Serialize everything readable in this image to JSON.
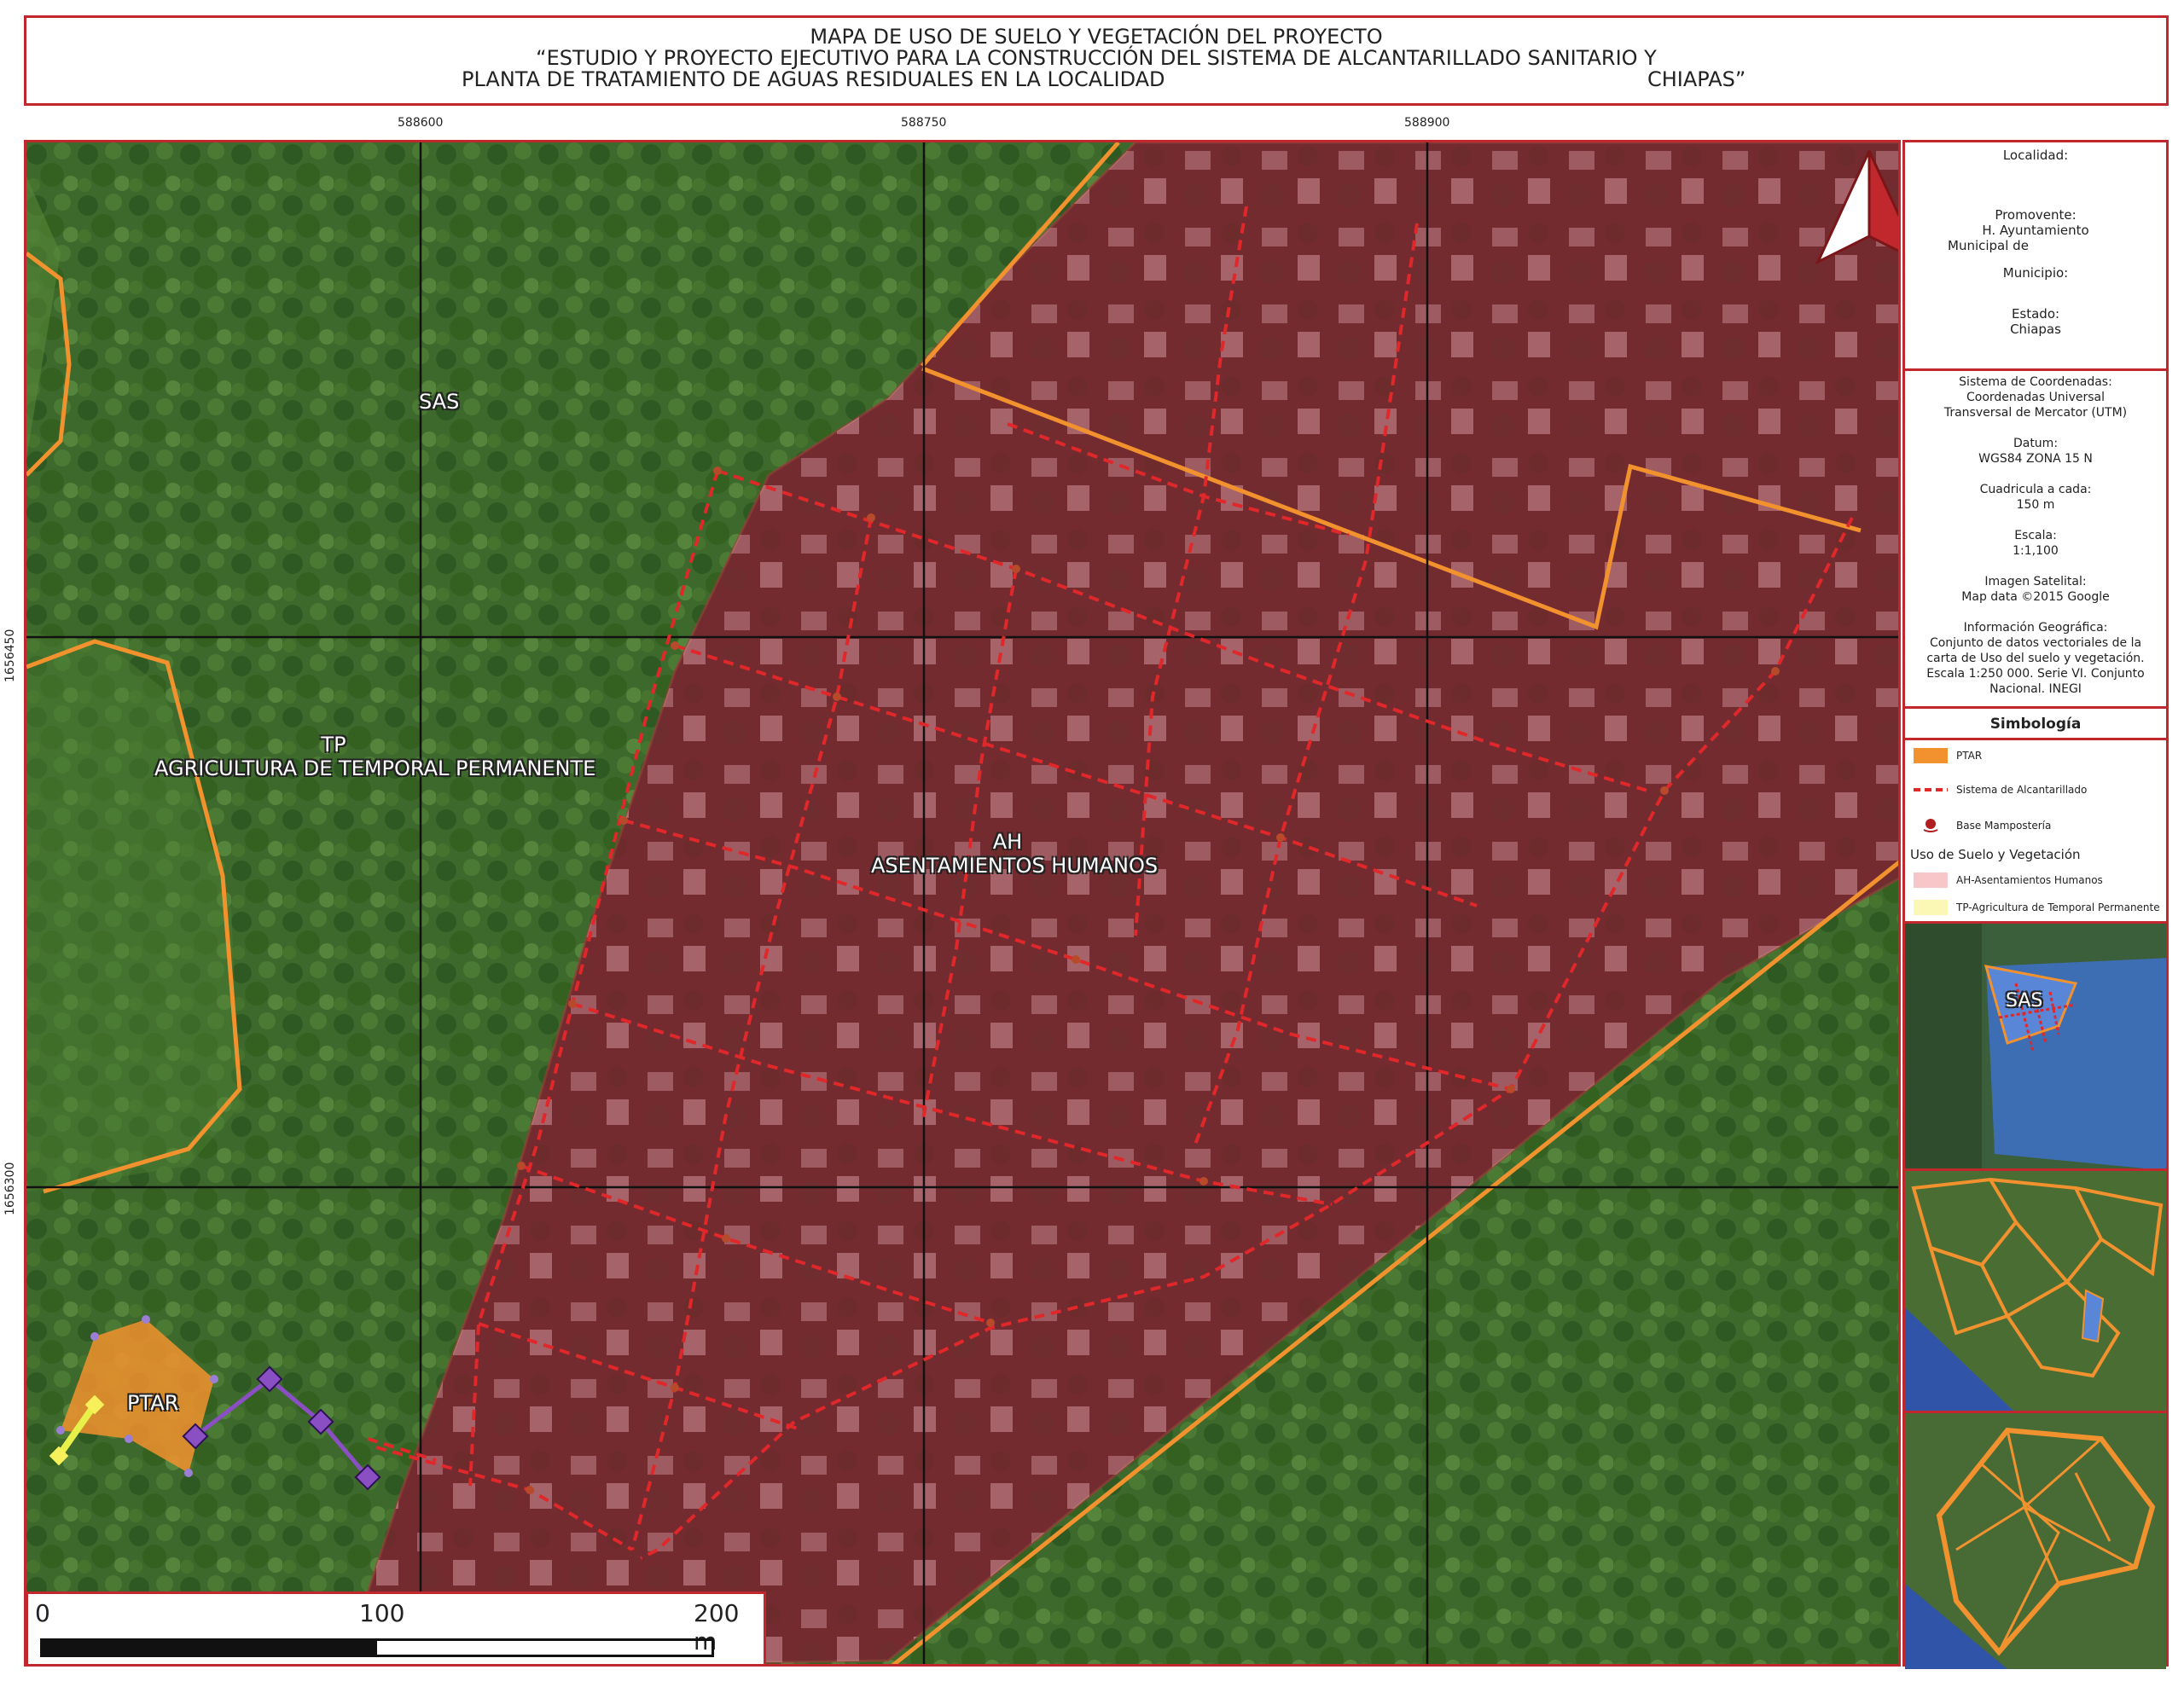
{
  "title": {
    "line1": "MAPA DE USO DE SUELO Y VEGETACIÓN DEL PROYECTO",
    "line2": "“ESTUDIO Y PROYECTO EJECUTIVO PARA LA CONSTRUCCIÓN DEL SISTEMA DE ALCANTARILLADO SANITARIO Y",
    "line3_left": "PLANTA DE TRATAMIENTO DE AGUAS RESIDUALES EN LA LOCALIDAD",
    "line3_right": "CHIAPAS”"
  },
  "grid": {
    "x_ticks": [
      "588600",
      "588750",
      "588900"
    ],
    "y_ticks": [
      "1656450",
      "1656300"
    ]
  },
  "map_labels": {
    "sas": "SAS",
    "tp_code": "TP",
    "tp_name": "AGRICULTURA DE TEMPORAL PERMANENTE",
    "ah_code": "AH",
    "ah_name": "ASENTAMIENTOS HUMANOS",
    "ptar": "PTAR"
  },
  "scalebar": {
    "labels": [
      "0",
      "100",
      "200 m"
    ]
  },
  "info": {
    "localidad": "Localidad:",
    "promovente_label": "Promovente:",
    "promovente_line1": "H. Ayuntamiento",
    "promovente_line2": "Municipal de",
    "municipio": "Municipio:",
    "estado_label": "Estado:",
    "estado_value": "Chiapas"
  },
  "coords": {
    "sistema_label": "Sistema de Coordenadas:",
    "sistema_line1": "Coordenadas Universal",
    "sistema_line2": "Transversal de Mercator (UTM)",
    "datum_label": "Datum:",
    "datum_value": "WGS84 ZONA 15 N",
    "cuadricula_label": "Cuadricula a cada:",
    "cuadricula_value": "150 m",
    "escala_label": "Escala:",
    "escala_value": "1:1,100",
    "imagen_label": "Imagen Satelital:",
    "imagen_value": "Map data ©2015 Google",
    "info_label": "Información Geográfica:",
    "info_line1": "Conjunto de datos vectoriales de la",
    "info_line2": "carta de Uso del suelo y vegetación.",
    "info_line3": "Escala 1:250 000. Serie VI. Conjunto",
    "info_line4": "Nacional. INEGI"
  },
  "legend": {
    "title": "Simbología",
    "ptar": "PTAR",
    "alcantarillado": "Sistema de Alcantarillado",
    "base": "Base Mampostería",
    "uso_title": "Uso de Suelo y Vegetación",
    "ah": "AH-Asentamientos Humanos",
    "tp": "TP-Agricultura de Temporal Permanente"
  },
  "inset": {
    "sas": "SAS"
  },
  "colors": {
    "frame": "#c0282d",
    "ah_fill": "#8a1f2f",
    "boundary": "#f2922e",
    "sewer": "#e0272a",
    "ptar_fill": "#f2922e",
    "pipe": "#8b4fc4",
    "vegetation": "#3d6a2c",
    "legend_ah": "#f6c6c8",
    "legend_tp": "#fbf7b4"
  }
}
